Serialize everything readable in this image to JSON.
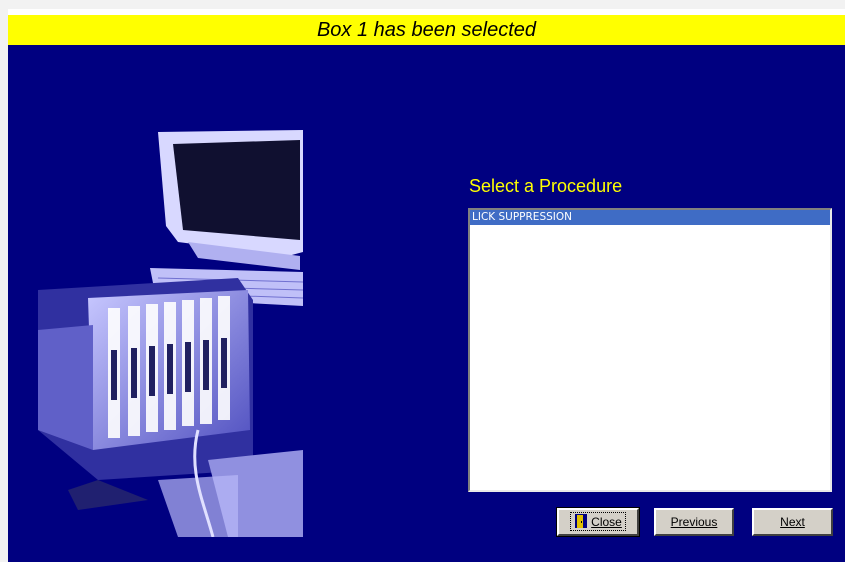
{
  "banner": {
    "text": "Box 1 has been selected"
  },
  "colors": {
    "banner": "#ffff00",
    "background": "#000080",
    "title": "#ffff00",
    "selection": "#3f6cc5"
  },
  "procedure": {
    "title": "Select a Procedure",
    "items": [
      {
        "label": "LICK SUPPRESSION",
        "selected": true
      }
    ]
  },
  "buttons": {
    "close": {
      "label": "Close",
      "icon": "door-exit-icon"
    },
    "previous": {
      "label": "Previous"
    },
    "next": {
      "label": "Next"
    }
  }
}
